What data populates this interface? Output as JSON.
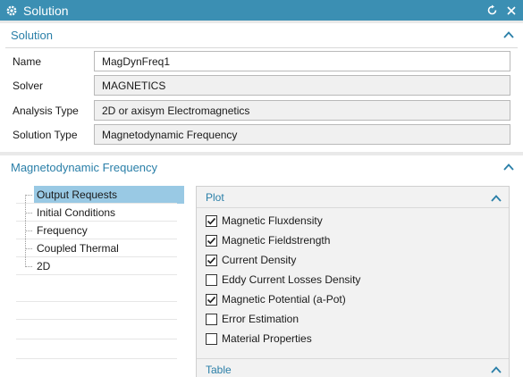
{
  "window": {
    "title": "Solution"
  },
  "solution_section": {
    "header": "Solution",
    "fields": [
      {
        "label": "Name",
        "value": "MagDynFreq1"
      },
      {
        "label": "Solver",
        "value": "MAGNETICS"
      },
      {
        "label": "Analysis Type",
        "value": "2D or axisym Electromagnetics"
      },
      {
        "label": "Solution Type",
        "value": "Magnetodynamic Frequency"
      }
    ]
  },
  "mdf_section": {
    "header": "Magnetodynamic Frequency",
    "tree_items": [
      "Output Requests",
      "Initial Conditions",
      "Frequency",
      "Coupled Thermal",
      "2D"
    ],
    "selected_item": "Output Requests",
    "plot": {
      "header": "Plot",
      "options": [
        {
          "label": "Magnetic Fluxdensity",
          "checked": true
        },
        {
          "label": "Magnetic Fieldstrength",
          "checked": true
        },
        {
          "label": "Current Density",
          "checked": true
        },
        {
          "label": "Eddy Current Losses Density",
          "checked": false
        },
        {
          "label": "Magnetic Potential (a-Pot)",
          "checked": true
        },
        {
          "label": "Error Estimation",
          "checked": false
        },
        {
          "label": "Material Properties",
          "checked": false
        }
      ]
    },
    "table": {
      "header": "Table"
    }
  },
  "icons": {
    "title_icon": "gear-icon",
    "reset_icon": "reset-icon",
    "close_icon": "close-icon",
    "collapse_icon": "chevron-up-icon"
  },
  "colors": {
    "titlebar": "#3b8fb3",
    "section_header": "#2a7fa8",
    "selection": "#99c9e4"
  }
}
